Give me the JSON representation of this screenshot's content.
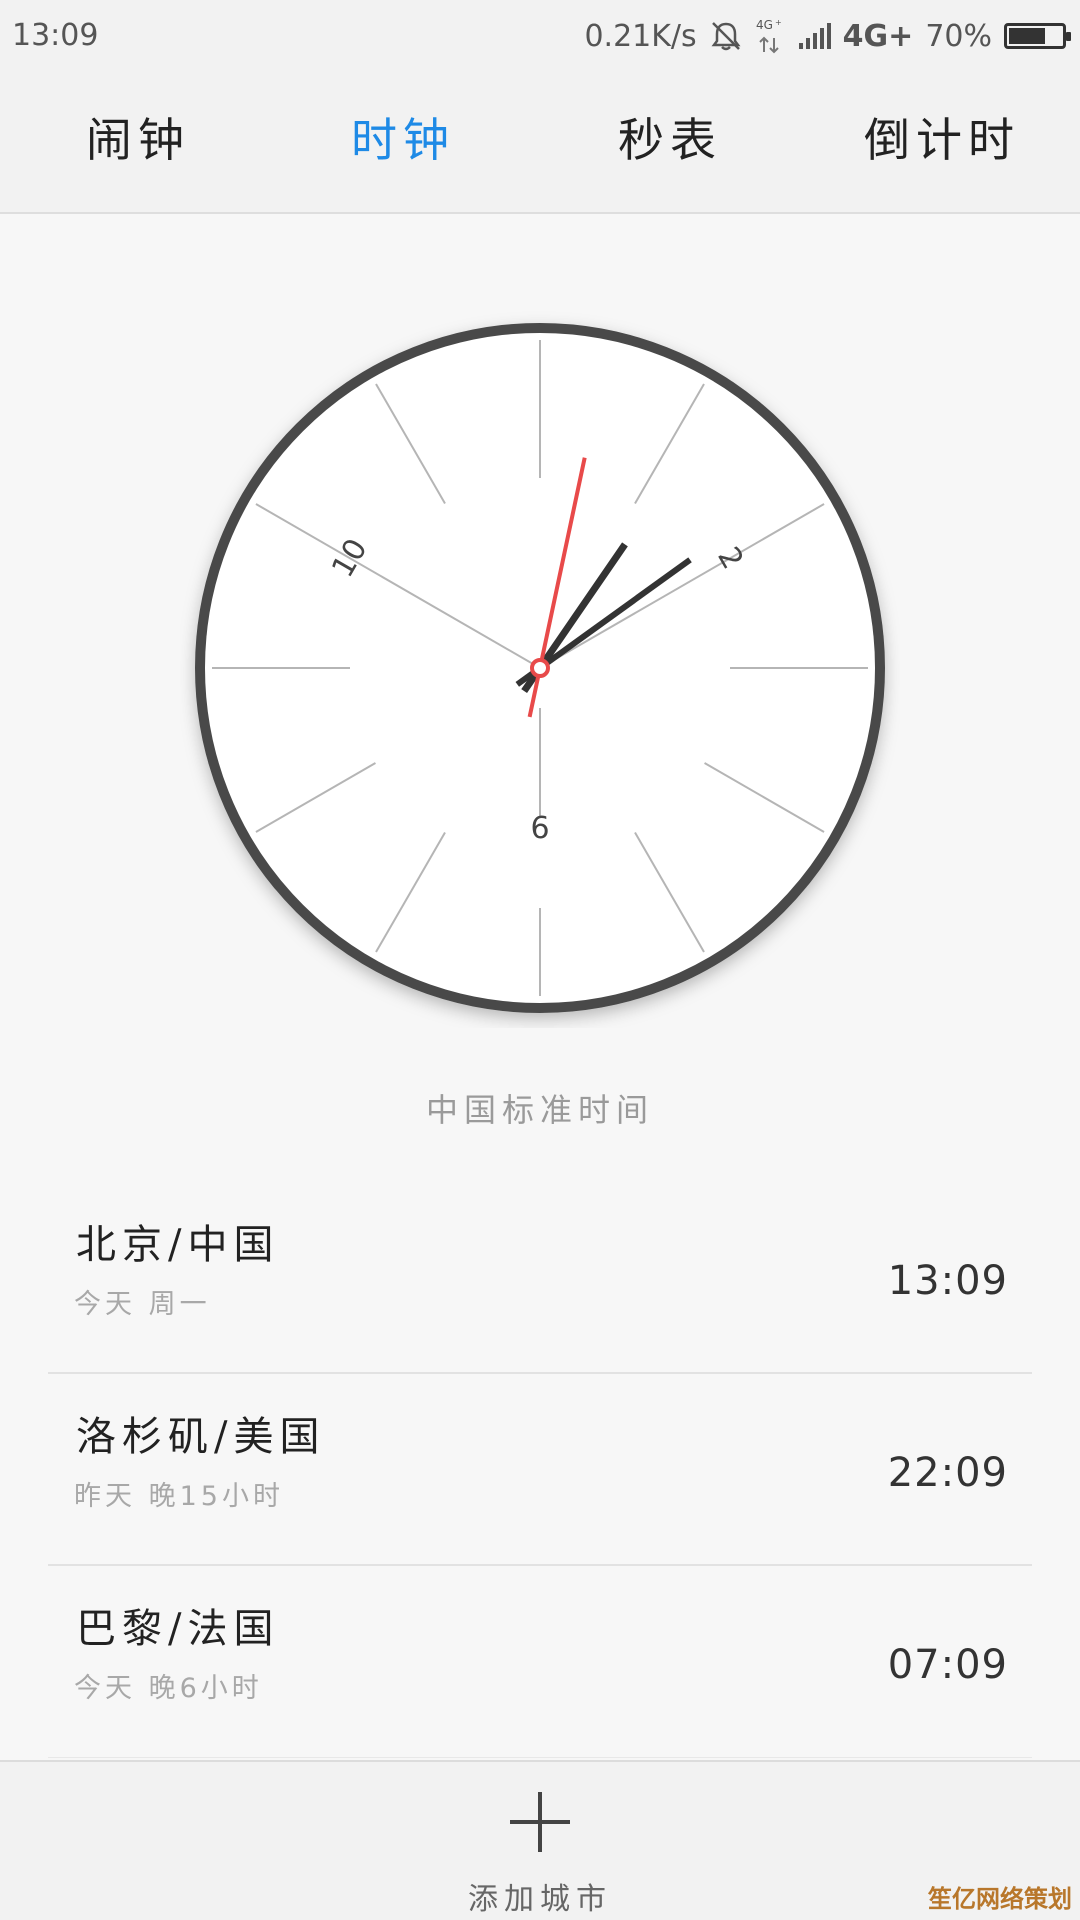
{
  "status_bar": {
    "time": "13:09",
    "net_speed": "0.21K/s",
    "net_type": "4G+",
    "small_net_label": "4G",
    "battery_text": "70%",
    "battery_level": 0.7,
    "icons": [
      "bell-off-icon",
      "data-arrows-icon",
      "signal-icon",
      "battery-icon"
    ]
  },
  "tabs": [
    {
      "label": "闹钟",
      "active": false
    },
    {
      "label": "时钟",
      "active": true
    },
    {
      "label": "秒表",
      "active": false
    },
    {
      "label": "倒计时",
      "active": false
    }
  ],
  "clock": {
    "numerals": [
      "10",
      "2",
      "6"
    ],
    "time_shown": "13:09",
    "second_hand_seconds": 2,
    "colors": {
      "rim": "#4a4a4a",
      "hands": "#333333",
      "second_hand": "#e84a4a",
      "ticks": "#b5b5b5"
    },
    "timezone_label": "中国标准时间"
  },
  "cities": [
    {
      "name": "北京/中国",
      "sub": "今天 周一",
      "time": "13:09"
    },
    {
      "name": "洛杉矶/美国",
      "sub": "昨天 晚15小时",
      "time": "22:09"
    },
    {
      "name": "巴黎/法国",
      "sub": "今天 晚6小时",
      "time": "07:09"
    }
  ],
  "bottom": {
    "add_label": "添加城市",
    "add_icon": "plus-icon"
  },
  "watermark": "笙亿网络策划",
  "accent_color": "#1e8ae6"
}
